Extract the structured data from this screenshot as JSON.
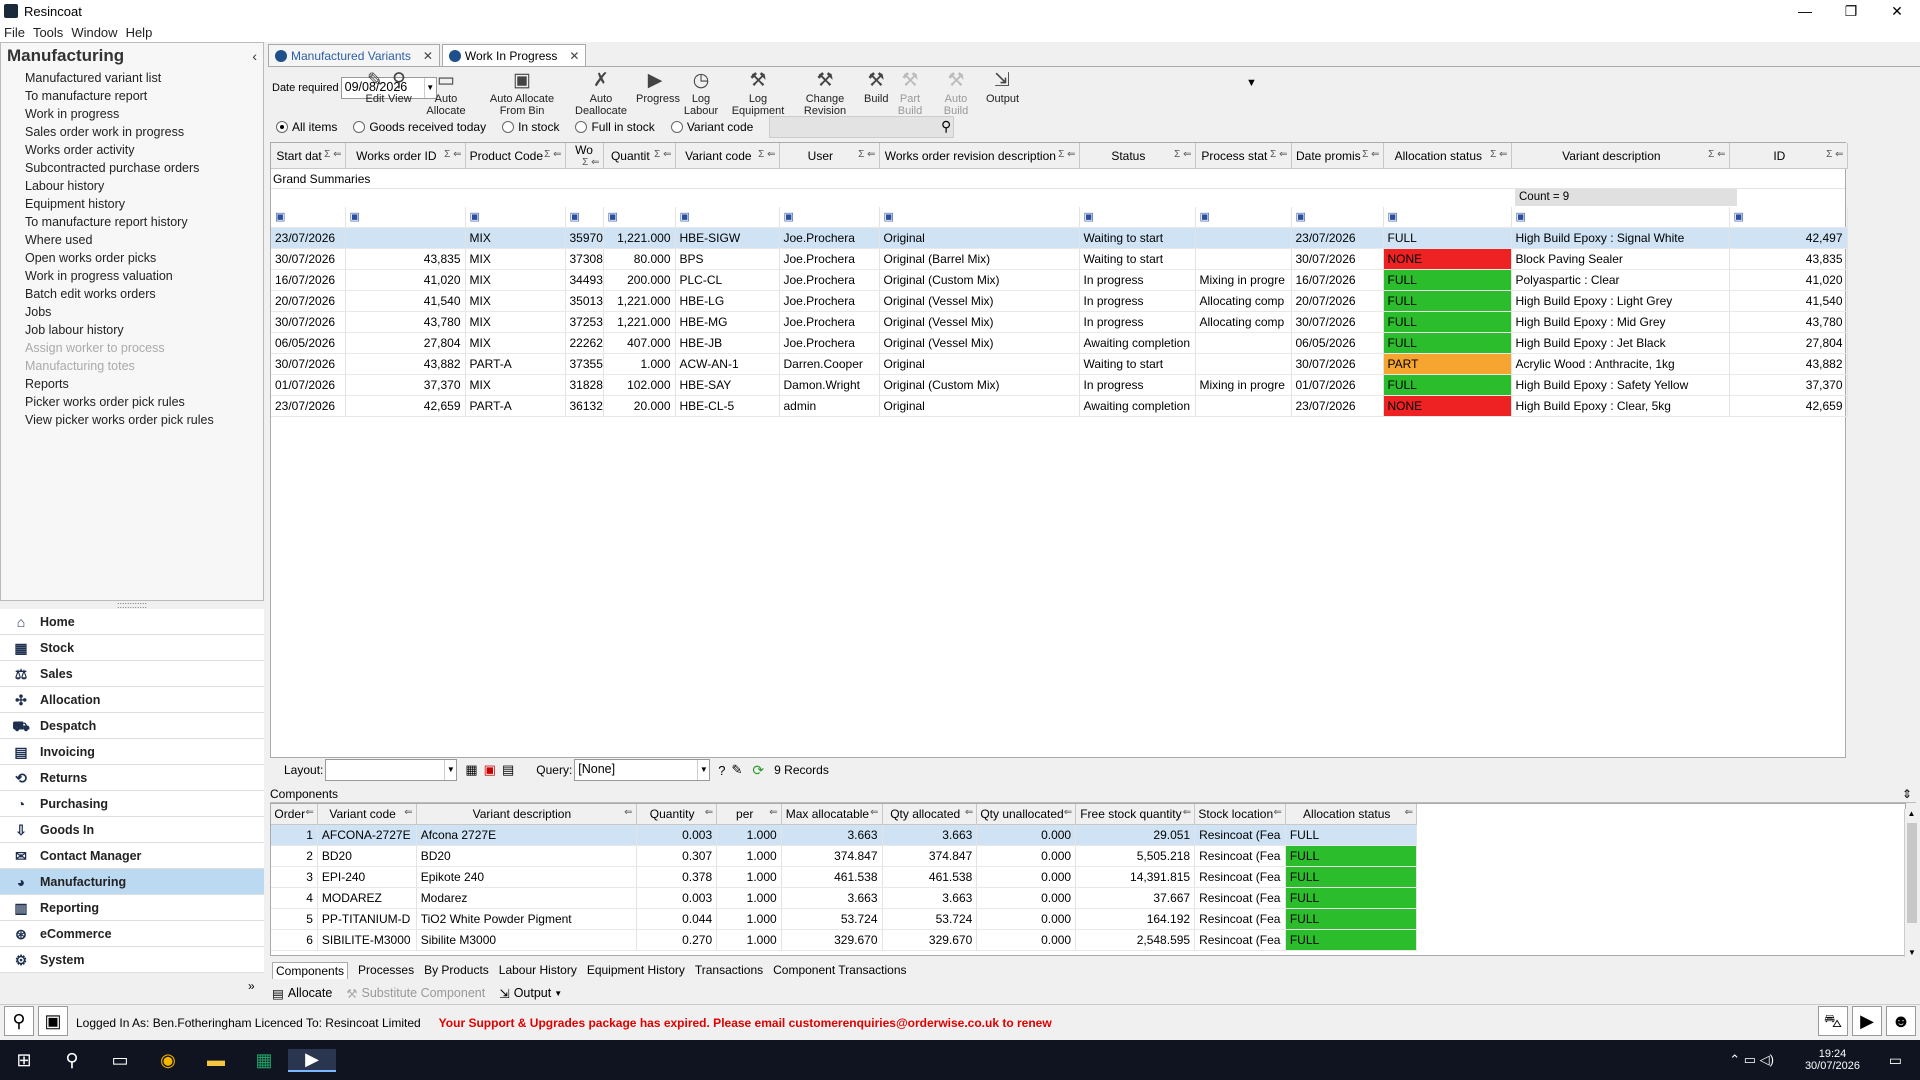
{
  "window": {
    "title": "Resincoat",
    "minimize": "—",
    "maximize": "❐",
    "close": "✕"
  },
  "menu": [
    "File",
    "Tools",
    "Window",
    "Help"
  ],
  "left": {
    "header": "Manufacturing",
    "collapse": "‹",
    "items": [
      {
        "label": "Manufactured variant list",
        "enabled": true
      },
      {
        "label": "To manufacture report",
        "enabled": true
      },
      {
        "label": "Work in progress",
        "enabled": true
      },
      {
        "label": "Sales order work in progress",
        "enabled": true
      },
      {
        "label": "Works order activity",
        "enabled": true
      },
      {
        "label": "Subcontracted purchase orders",
        "enabled": true
      },
      {
        "label": "Labour history",
        "enabled": true
      },
      {
        "label": "Equipment history",
        "enabled": true
      },
      {
        "label": "To manufacture report history",
        "enabled": true
      },
      {
        "label": "Where used",
        "enabled": true
      },
      {
        "label": "Open works order picks",
        "enabled": true
      },
      {
        "label": "Work in progress valuation",
        "enabled": true
      },
      {
        "label": "Batch edit works orders",
        "enabled": true
      },
      {
        "label": "Jobs",
        "enabled": true
      },
      {
        "label": "Job labour history",
        "enabled": true
      },
      {
        "label": "Assign worker to process",
        "enabled": false
      },
      {
        "label": "Manufacturing totes",
        "enabled": false
      },
      {
        "label": "Reports",
        "enabled": true
      },
      {
        "label": "Picker works order pick rules",
        "enabled": true
      },
      {
        "label": "View picker works order pick rules",
        "enabled": true
      }
    ]
  },
  "splitter": "::::::::::::",
  "modules": [
    {
      "label": "Home",
      "icon": "home-icon",
      "glyph": "⌂",
      "selected": false
    },
    {
      "label": "Stock",
      "icon": "stock-icon",
      "glyph": "▦",
      "selected": false
    },
    {
      "label": "Sales",
      "icon": "sales-icon",
      "glyph": "⚖",
      "selected": false
    },
    {
      "label": "Allocation",
      "icon": "allocation-icon",
      "glyph": "✣",
      "selected": false
    },
    {
      "label": "Despatch",
      "icon": "truck-icon",
      "glyph": "⛟",
      "selected": false
    },
    {
      "label": "Invoicing",
      "icon": "invoice-icon",
      "glyph": "▤",
      "selected": false
    },
    {
      "label": "Returns",
      "icon": "returns-icon",
      "glyph": "⟲",
      "selected": false
    },
    {
      "label": "Purchasing",
      "icon": "purchasing-icon",
      "glyph": "◔",
      "selected": false
    },
    {
      "label": "Goods In",
      "icon": "goods-in-icon",
      "glyph": "⇩",
      "selected": false
    },
    {
      "label": "Contact Manager",
      "icon": "contact-icon",
      "glyph": "✉",
      "selected": false
    },
    {
      "label": "Manufacturing",
      "icon": "manufacturing-icon",
      "glyph": "◕",
      "selected": true
    },
    {
      "label": "Reporting",
      "icon": "reporting-icon",
      "glyph": "▥",
      "selected": false
    },
    {
      "label": "eCommerce",
      "icon": "ecommerce-icon",
      "glyph": "⊛",
      "selected": false
    },
    {
      "label": "System",
      "icon": "system-icon",
      "glyph": "⚙",
      "selected": false
    }
  ],
  "modexpand": "»",
  "tabs": [
    {
      "label": "Manufactured Variants",
      "active": false
    },
    {
      "label": "Work In Progress",
      "active": true
    }
  ],
  "tabclose": "✕",
  "toolbar": {
    "date_label": "Date required",
    "date_value": "09/08/2026",
    "buttons": [
      {
        "label": "Edit",
        "icon": "edit-icon",
        "glyph": "✎",
        "enabled": true
      },
      {
        "label": "View",
        "icon": "view-icon",
        "glyph": "⚲",
        "enabled": true
      },
      {
        "label": "Auto Allocate",
        "icon": "auto-allocate-icon",
        "glyph": "▭",
        "enabled": true
      },
      {
        "label": "Auto Allocate From Bin",
        "icon": "bin-icon",
        "glyph": "▣",
        "enabled": true
      },
      {
        "label": "Auto Deallocate",
        "icon": "deallocate-icon",
        "glyph": "✗",
        "enabled": true
      },
      {
        "label": "Progress",
        "icon": "progress-icon",
        "glyph": "▶",
        "enabled": true
      },
      {
        "label": "Log Labour",
        "icon": "clock-icon",
        "glyph": "◷",
        "enabled": true
      },
      {
        "label": "Log Equipment",
        "icon": "equipment-icon",
        "glyph": "⚒",
        "enabled": true
      },
      {
        "label": "Change Revision",
        "icon": "revision-icon",
        "glyph": "⚒",
        "enabled": true
      },
      {
        "label": "Build",
        "icon": "build-icon",
        "glyph": "⚒",
        "enabled": true
      },
      {
        "label": "Part Build",
        "icon": "part-build-icon",
        "glyph": "⚒",
        "enabled": false
      },
      {
        "label": "Auto Build",
        "icon": "auto-build-icon",
        "glyph": "⚒",
        "enabled": false
      },
      {
        "label": "Output",
        "icon": "output-icon",
        "glyph": "⇲",
        "enabled": true
      }
    ],
    "output_arrow": "▼"
  },
  "filters": [
    {
      "label": "All items",
      "checked": true
    },
    {
      "label": "Goods received today",
      "checked": false
    },
    {
      "label": "In stock",
      "checked": false
    },
    {
      "label": "Full in stock",
      "checked": false
    },
    {
      "label": "Variant code",
      "checked": false
    }
  ],
  "grid": {
    "columns": [
      "Start dat",
      "Works order ID",
      "Product Code",
      "Wo",
      "Quantit",
      "Variant code",
      "User",
      "Works order revision description",
      "Status",
      "Process stat",
      "Date promis",
      "Allocation status",
      "Variant description",
      "ID"
    ],
    "grand_summaries": "Grand Summaries",
    "count": "Count = 9",
    "rows": [
      {
        "start": "23/07/2026",
        "woid": "",
        "product": "MIX",
        "wo": "35970",
        "qty": "1,221.000",
        "variant": "HBE-SIGW",
        "user": "Joe.Prochera",
        "rev": "Original",
        "status": "Waiting to start",
        "proc": "",
        "date": "23/07/2026",
        "alloc": "FULL",
        "desc": "High Build Epoxy : Signal White",
        "id": "42,497",
        "selected": true
      },
      {
        "start": "30/07/2026",
        "woid": "43,835",
        "product": "MIX",
        "wo": "37308",
        "qty": "80.000",
        "variant": "BPS",
        "user": "Joe.Prochera",
        "rev": "Original (Barrel Mix)",
        "status": "Waiting to start",
        "proc": "",
        "date": "30/07/2026",
        "alloc": "NONE",
        "desc": "Block Paving Sealer",
        "id": "43,835",
        "selected": false
      },
      {
        "start": "16/07/2026",
        "woid": "41,020",
        "product": "MIX",
        "wo": "34493",
        "qty": "200.000",
        "variant": "PLC-CL",
        "user": "Joe.Prochera",
        "rev": "Original (Custom Mix)",
        "status": "In progress",
        "proc": "Mixing in progre",
        "date": "16/07/2026",
        "alloc": "FULL",
        "desc": "Polyaspartic : Clear",
        "id": "41,020",
        "selected": false
      },
      {
        "start": "20/07/2026",
        "woid": "41,540",
        "product": "MIX",
        "wo": "35013",
        "qty": "1,221.000",
        "variant": "HBE-LG",
        "user": "Joe.Prochera",
        "rev": "Original (Vessel Mix)",
        "status": "In progress",
        "proc": "Allocating comp",
        "date": "20/07/2026",
        "alloc": "FULL",
        "desc": "High Build Epoxy : Light Grey",
        "id": "41,540",
        "selected": false
      },
      {
        "start": "30/07/2026",
        "woid": "43,780",
        "product": "MIX",
        "wo": "37253",
        "qty": "1,221.000",
        "variant": "HBE-MG",
        "user": "Joe.Prochera",
        "rev": "Original (Vessel Mix)",
        "status": "In progress",
        "proc": "Allocating comp",
        "date": "30/07/2026",
        "alloc": "FULL",
        "desc": "High Build Epoxy : Mid Grey",
        "id": "43,780",
        "selected": false
      },
      {
        "start": "06/05/2026",
        "woid": "27,804",
        "product": "MIX",
        "wo": "22262",
        "qty": "407.000",
        "variant": "HBE-JB",
        "user": "Joe.Prochera",
        "rev": "Original (Vessel Mix)",
        "status": "Awaiting completion",
        "proc": "",
        "date": "06/05/2026",
        "alloc": "FULL",
        "desc": "High Build Epoxy : Jet Black",
        "id": "27,804",
        "selected": false
      },
      {
        "start": "30/07/2026",
        "woid": "43,882",
        "product": "PART-A",
        "wo": "37355",
        "qty": "1.000",
        "variant": "ACW-AN-1",
        "user": "Darren.Cooper",
        "rev": "Original",
        "status": "Waiting to start",
        "proc": "",
        "date": "30/07/2026",
        "alloc": "PART",
        "desc": "Acrylic Wood : Anthracite, 1kg",
        "id": "43,882",
        "selected": false
      },
      {
        "start": "01/07/2026",
        "woid": "37,370",
        "product": "MIX",
        "wo": "31828",
        "qty": "102.000",
        "variant": "HBE-SAY",
        "user": "Damon.Wright",
        "rev": "Original (Custom Mix)",
        "status": "In progress",
        "proc": "Mixing in progre",
        "date": "01/07/2026",
        "alloc": "FULL",
        "desc": "High Build Epoxy : Safety Yellow",
        "id": "37,370",
        "selected": false
      },
      {
        "start": "23/07/2026",
        "woid": "42,659",
        "product": "PART-A",
        "wo": "36132",
        "qty": "20.000",
        "variant": "HBE-CL-5",
        "user": "admin",
        "rev": "Original",
        "status": "Awaiting completion",
        "proc": "",
        "date": "23/07/2026",
        "alloc": "NONE",
        "desc": "High Build Epoxy : Clear, 5kg",
        "id": "42,659",
        "selected": false
      }
    ]
  },
  "layoutbar": {
    "layout_label": "Layout:",
    "layout_value": "",
    "query_label": "Query:",
    "query_value": "[None]",
    "records": "9 Records"
  },
  "components": {
    "title": "Components",
    "pin": "⇕",
    "columns": [
      "Order",
      "Variant code",
      "Variant description",
      "Quantity",
      "per",
      "Max allocatable",
      "Qty allocated",
      "Qty unallocated",
      "Free stock quantity",
      "Stock location",
      "Allocation status"
    ],
    "rows": [
      {
        "order": "1",
        "code": "AFCONA-2727E",
        "desc": "Afcona 2727E",
        "qty": "0.003",
        "per": "1.000",
        "max": "3.663",
        "alloc": "3.663",
        "unalloc": "0.000",
        "free": "29.051",
        "loc": "Resincoat (Fea",
        "status": "FULL",
        "selected": true
      },
      {
        "order": "2",
        "code": "BD20",
        "desc": "BD20",
        "qty": "0.307",
        "per": "1.000",
        "max": "374.847",
        "alloc": "374.847",
        "unalloc": "0.000",
        "free": "5,505.218",
        "loc": "Resincoat (Fea",
        "status": "FULL",
        "selected": false
      },
      {
        "order": "3",
        "code": "EPI-240",
        "desc": "Epikote 240",
        "qty": "0.378",
        "per": "1.000",
        "max": "461.538",
        "alloc": "461.538",
        "unalloc": "0.000",
        "free": "14,391.815",
        "loc": "Resincoat (Fea",
        "status": "FULL",
        "selected": false
      },
      {
        "order": "4",
        "code": "MODAREZ",
        "desc": "Modarez",
        "qty": "0.003",
        "per": "1.000",
        "max": "3.663",
        "alloc": "3.663",
        "unalloc": "0.000",
        "free": "37.667",
        "loc": "Resincoat (Fea",
        "status": "FULL",
        "selected": false
      },
      {
        "order": "5",
        "code": "PP-TITANIUM-D",
        "desc": "TiO2 White Powder Pigment",
        "qty": "0.044",
        "per": "1.000",
        "max": "53.724",
        "alloc": "53.724",
        "unalloc": "0.000",
        "free": "164.192",
        "loc": "Resincoat (Fea",
        "status": "FULL",
        "selected": false
      },
      {
        "order": "6",
        "code": "SIBILITE-M3000",
        "desc": "Sibilite M3000",
        "qty": "0.270",
        "per": "1.000",
        "max": "329.670",
        "alloc": "329.670",
        "unalloc": "0.000",
        "free": "2,548.595",
        "loc": "Resincoat (Fea",
        "status": "FULL",
        "selected": false
      }
    ],
    "tabs": [
      "Components",
      "Processes",
      "By Products",
      "Labour History",
      "Equipment History",
      "Transactions",
      "Component Transactions"
    ],
    "actions": {
      "allocate": "Allocate",
      "substitute": "Substitute Component",
      "output": "Output"
    }
  },
  "status": {
    "logged": "Logged In As: Ben.Fotheringham  Licenced To: Resincoat Limited",
    "warning": "Your Support & Upgrades package has expired. Please email customerenquiries@orderwise.co.uk to renew"
  },
  "taskbar": {
    "time": "19:24",
    "date": "30/07/2026"
  },
  "colors": {
    "full": "#2cbd2c",
    "none": "#ee2222",
    "part": "#f7a531",
    "selected_row": "#cfe3f4",
    "module_selected": "#bcd9f2",
    "warning": "#e00000"
  }
}
